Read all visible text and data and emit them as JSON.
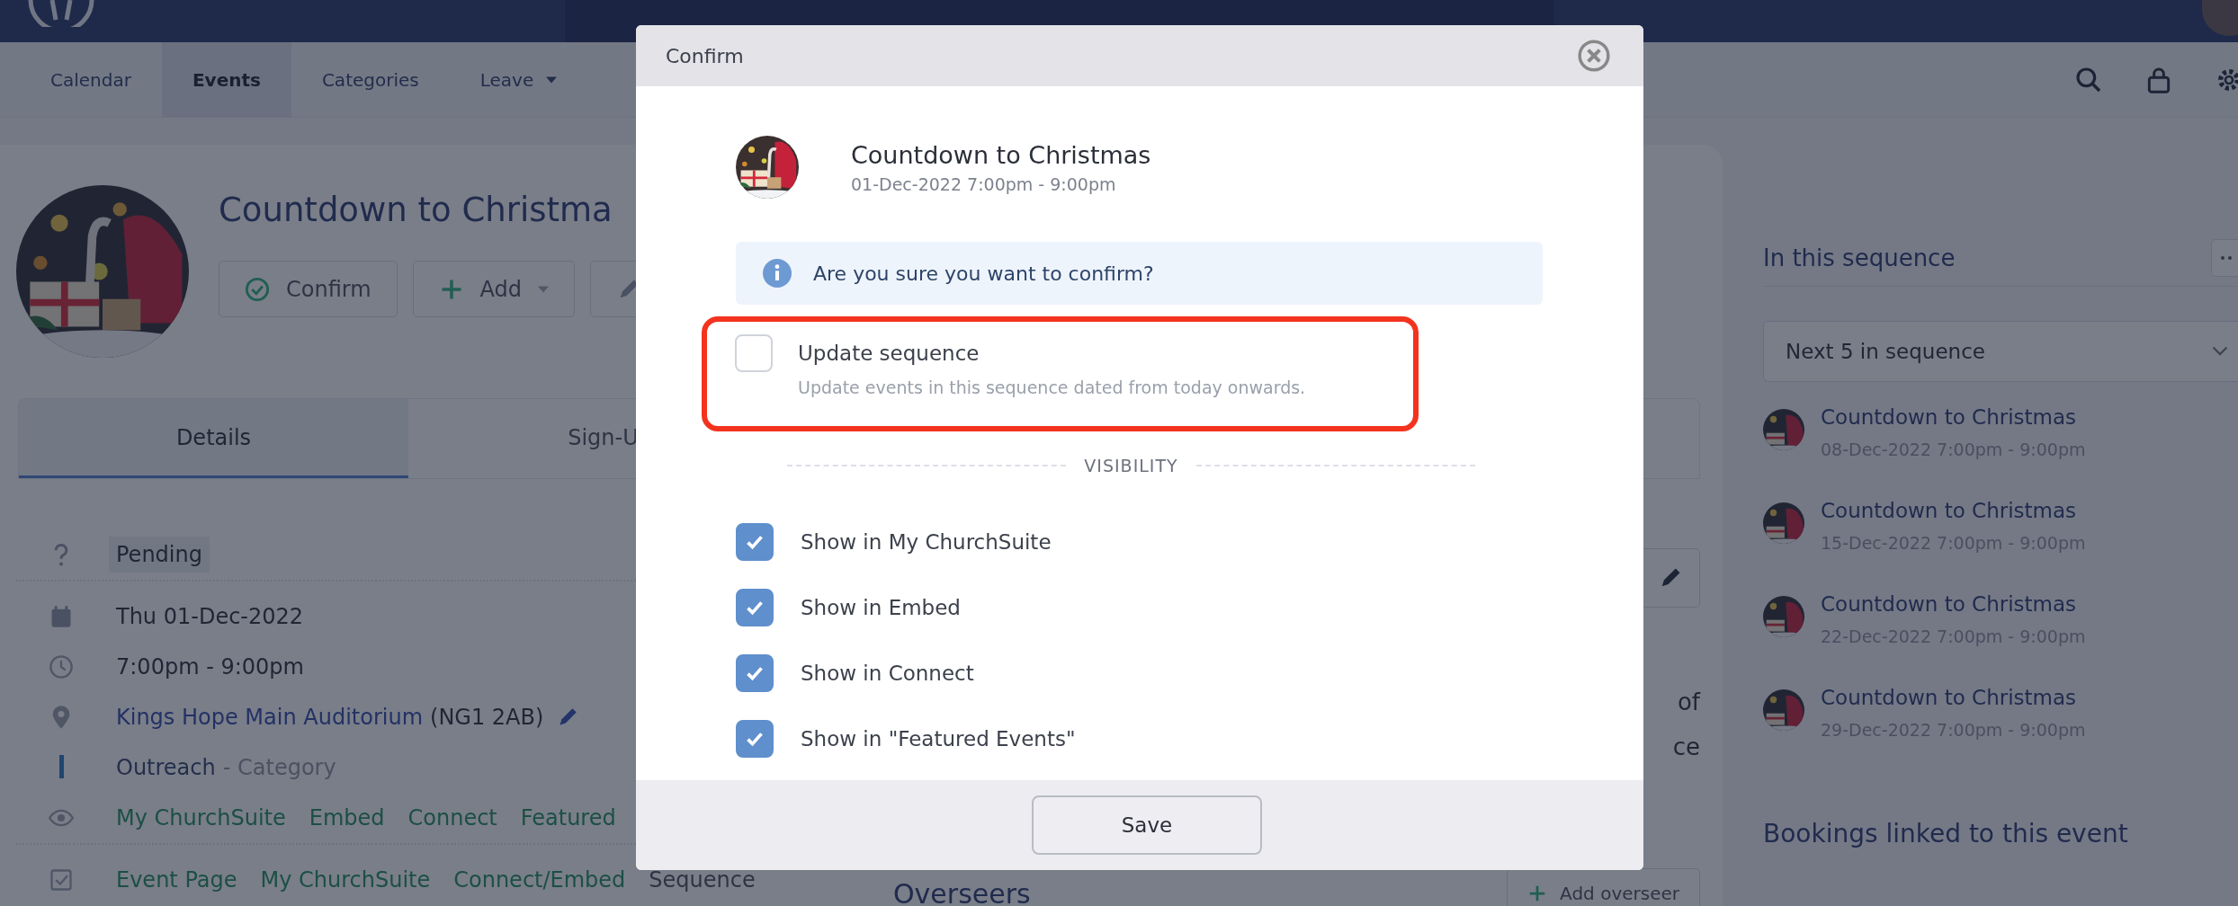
{
  "nav": {
    "tabs": [
      {
        "label": "Calendar",
        "selected": false,
        "dropdown": false
      },
      {
        "label": "Events",
        "selected": true,
        "dropdown": false
      },
      {
        "label": "Categories",
        "selected": false,
        "dropdown": false
      },
      {
        "label": "Leave",
        "selected": false,
        "dropdown": true
      }
    ]
  },
  "event": {
    "title": "Countdown to Christma",
    "actions": [
      {
        "kind": "confirm",
        "label": "Confirm"
      },
      {
        "kind": "add",
        "label": "Add"
      },
      {
        "kind": "edit"
      }
    ],
    "tabs": [
      {
        "label": "Details",
        "selected": true
      },
      {
        "label": "Sign-U",
        "selected": false
      }
    ],
    "details": [
      {
        "kind": "status",
        "text": "Pending"
      },
      {
        "kind": "date",
        "text": "Thu 01-Dec-2022"
      },
      {
        "kind": "time",
        "text": "7:00pm - 9:00pm"
      },
      {
        "kind": "location",
        "link": "Kings Hope Main Auditorium",
        "text": "(NG1 2AB)"
      },
      {
        "kind": "category",
        "link": "Outreach",
        "text": "- Category"
      },
      {
        "kind": "visibility",
        "tags": [
          {
            "label": "My ChurchSuite",
            "active": true
          },
          {
            "label": "Embed",
            "active": true
          },
          {
            "label": "Connect",
            "active": true
          },
          {
            "label": "Featured",
            "active": true
          }
        ]
      },
      {
        "kind": "pages",
        "tags": [
          {
            "label": "Event Page",
            "active": true
          },
          {
            "label": "My ChurchSuite",
            "active": true
          },
          {
            "label": "Connect/Embed",
            "active": true
          },
          {
            "label": "Sequence",
            "active": false
          }
        ]
      }
    ]
  },
  "column_2": {
    "texts": [
      "of",
      "ce"
    ],
    "overseers_title": "Overseers",
    "add_button": "Add overseer"
  },
  "sequence": {
    "title": "In this sequence",
    "filter": "Next 5 in sequence",
    "items": [
      {
        "title": "Countdown to Christmas",
        "date": "08-Dec-2022 7:00pm - 9:00pm"
      },
      {
        "title": "Countdown to Christmas",
        "date": "15-Dec-2022 7:00pm - 9:00pm"
      },
      {
        "title": "Countdown to Christmas",
        "date": "22-Dec-2022 7:00pm - 9:00pm"
      },
      {
        "title": "Countdown to Christmas",
        "date": "29-Dec-2022 7:00pm - 9:00pm"
      }
    ]
  },
  "bookings": {
    "title": "Bookings linked to this event"
  },
  "modal": {
    "title": "Confirm",
    "event": {
      "title": "Countdown to Christmas",
      "date": "01-Dec-2022 7:00pm - 9:00pm"
    },
    "alert": "Are you sure you want to confirm?",
    "update": {
      "label": "Update sequence",
      "hint": "Update events in this sequence dated from today onwards.",
      "checked": false
    },
    "section": "VISIBILITY",
    "options": [
      {
        "label": "Show in My ChurchSuite",
        "checked": true
      },
      {
        "label": "Show in Embed",
        "checked": true
      },
      {
        "label": "Show in Connect",
        "checked": true
      },
      {
        "label": "Show in \"Featured Events\"",
        "checked": true
      }
    ],
    "save": "Save"
  }
}
